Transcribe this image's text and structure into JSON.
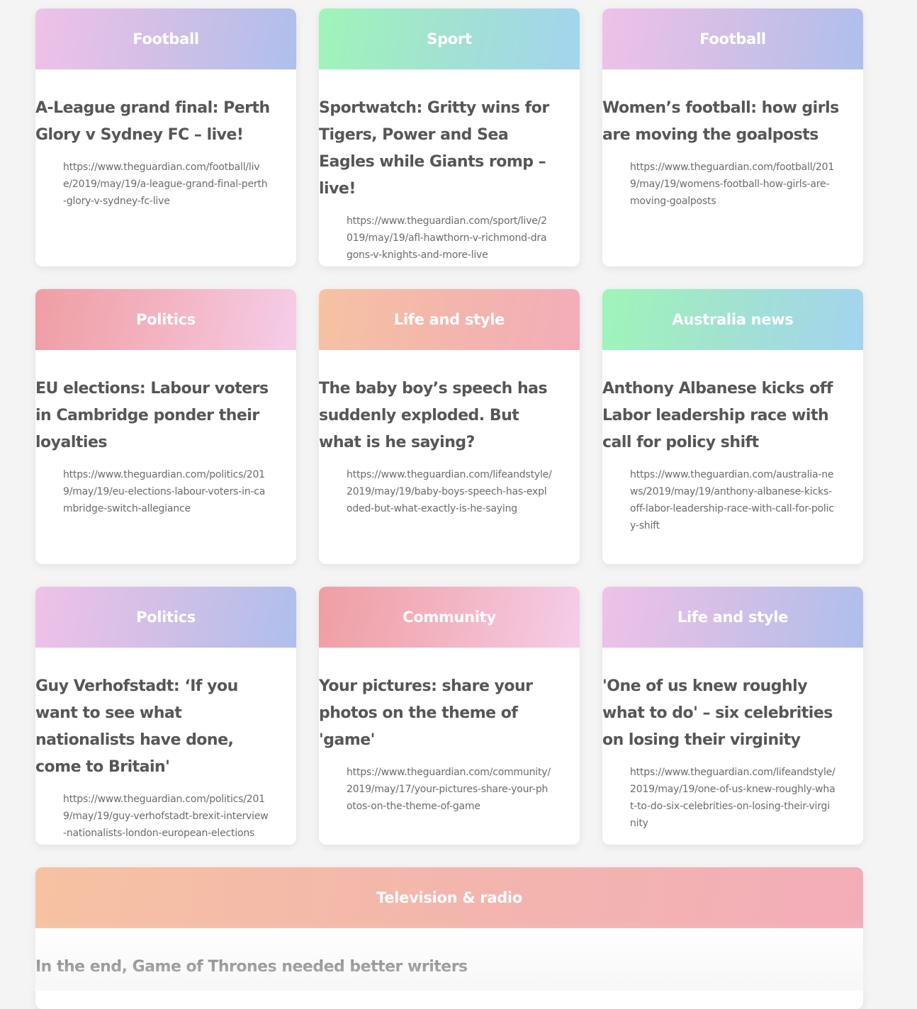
{
  "cards": [
    {
      "category": "Football",
      "gradient": "pink-blue",
      "title": "A-League grand final: Perth Glory v Sydney FC – live!",
      "url": "https://www.theguardian.com/football/live/2019/may/19/a-league-grand-final-perth-glory-v-sydney-fc-live"
    },
    {
      "category": "Sport",
      "gradient": "green-blue",
      "title": "Sportwatch: Gritty wins for Tigers, Power and Sea Eagles while Giants romp – live!",
      "url": "https://www.theguardian.com/sport/live/2019/may/19/afl-hawthorn-v-richmond-dragons-v-knights-and-more-live"
    },
    {
      "category": "Football",
      "gradient": "pink-blue",
      "title": "Women’s football: how girls are moving the goalposts",
      "url": "https://www.theguardian.com/football/2019/may/19/womens-football-how-girls-are-moving-goalposts"
    },
    {
      "category": "Politics",
      "gradient": "red-pink",
      "title": "EU elections: Labour voters in Cambridge ponder their loyalties",
      "url": "https://www.theguardian.com/politics/2019/may/19/eu-elections-labour-voters-in-cambridge-switch-allegiance"
    },
    {
      "category": "Life and style",
      "gradient": "peach-pink",
      "title": "The baby boy’s speech has suddenly exploded. But what is he saying?",
      "url": "https://www.theguardian.com/lifeandstyle/2019/may/19/baby-boys-speech-has-exploded-but-what-exactly-is-he-saying"
    },
    {
      "category": "Australia news",
      "gradient": "green-blue",
      "title": "Anthony Albanese kicks off Labor leadership race with call for policy shift",
      "url": "https://www.theguardian.com/australia-news/2019/may/19/anthony-albanese-kicks-off-labor-leadership-race-with-call-for-policy-shift"
    },
    {
      "category": "Politics",
      "gradient": "pink-blue",
      "title": "Guy Verhofstadt: ‘If you want to see what nationalists have done, come to Britain'",
      "url": "https://www.theguardian.com/politics/2019/may/19/guy-verhofstadt-brexit-interview-nationalists-london-european-elections"
    },
    {
      "category": "Community",
      "gradient": "red-pink",
      "title": "Your pictures: share your photos on the theme of 'game'",
      "url": "https://www.theguardian.com/community/2019/may/17/your-pictures-share-your-photos-on-the-theme-of-game"
    },
    {
      "category": "Life and style",
      "gradient": "pink-blue",
      "title": "'One of us knew roughly what to do' – six celebrities on losing their virginity",
      "url": "https://www.theguardian.com/lifeandstyle/2019/may/19/one-of-us-knew-roughly-what-to-do-six-celebrities-on-losing-their-virginity"
    },
    {
      "category": "Television & radio",
      "gradient": "peach-pink",
      "title": "In the end, Game of Thrones needed better writers",
      "url": ""
    }
  ]
}
